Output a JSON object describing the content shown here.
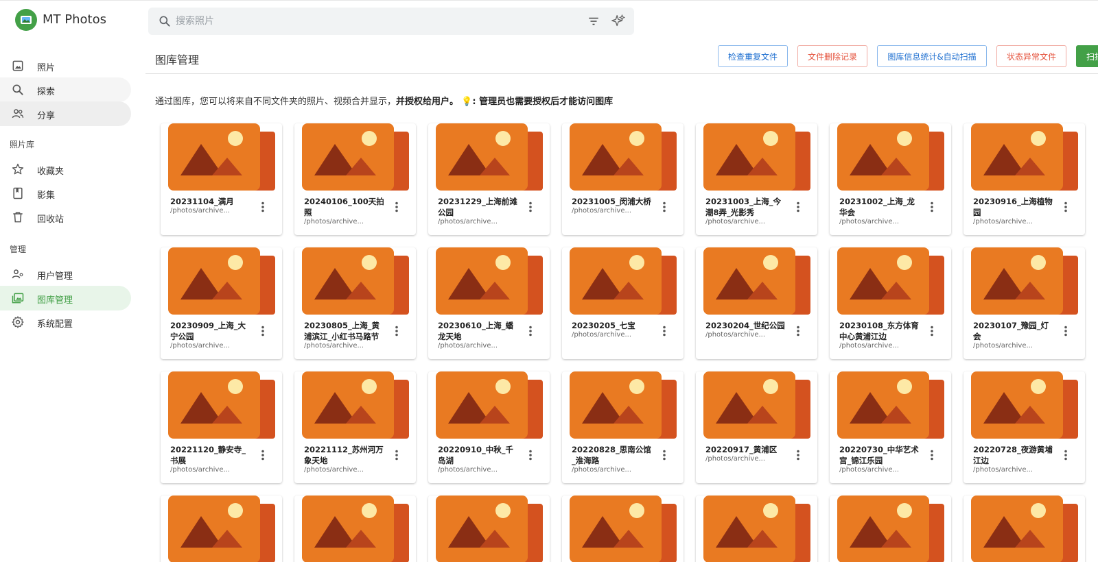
{
  "app": {
    "title": "MT Photos"
  },
  "search": {
    "placeholder": "搜索照片"
  },
  "sidebar": {
    "top_items": [
      {
        "label": "照片",
        "icon": "image-icon"
      },
      {
        "label": "探索",
        "icon": "search-icon"
      },
      {
        "label": "分享",
        "icon": "people-icon"
      }
    ],
    "section_library": "照片库",
    "library_items": [
      {
        "label": "收藏夹",
        "icon": "star-icon"
      },
      {
        "label": "影集",
        "icon": "album-icon"
      },
      {
        "label": "回收站",
        "icon": "trash-icon"
      }
    ],
    "section_manage": "管理",
    "manage_items": [
      {
        "label": "用户管理",
        "icon": "user-manage-icon"
      },
      {
        "label": "图库管理",
        "icon": "gallery-icon"
      },
      {
        "label": "系统配置",
        "icon": "gear-icon"
      }
    ]
  },
  "header": {
    "title": "图库管理",
    "buttons": [
      "检查重复文件",
      "文件删除记录",
      "图库信息统计&自动扫描",
      "状态异常文件",
      "扫描"
    ]
  },
  "intro": {
    "text": "通过图库，您可以将来自不同文件夹的照片、视频合并显示，",
    "bold": "并授权给用户。",
    "note": "💡: 管理员也需要授权后才能访问图库"
  },
  "galleries": [
    {
      "name": "20231104_满月",
      "path": "/photos/archive..."
    },
    {
      "name": "20240106_100天拍照",
      "path": "/photos/archive..."
    },
    {
      "name": "20231229_上海前滩公园",
      "path": "/photos/archive..."
    },
    {
      "name": "20231005_闵浦大桥",
      "path": "/photos/archive..."
    },
    {
      "name": "20231003_上海_今潮8弄_光影秀",
      "path": "/photos/archive..."
    },
    {
      "name": "20231002_上海_龙华会",
      "path": "/photos/archive..."
    },
    {
      "name": "20230916_上海植物园",
      "path": "/photos/archive..."
    },
    {
      "name": "20230909_上海_大宁公园",
      "path": "/photos/archive..."
    },
    {
      "name": "20230805_上海_黄浦滨江_小红书马路节",
      "path": "/photos/archive..."
    },
    {
      "name": "20230610_上海_蟠龙天地",
      "path": "/photos/archive..."
    },
    {
      "name": "20230205_七宝",
      "path": "/photos/archive..."
    },
    {
      "name": "20230204_世纪公园",
      "path": "/photos/archive..."
    },
    {
      "name": "20230108_东方体育中心黄浦江边",
      "path": "/photos/archive..."
    },
    {
      "name": "20230107_豫园_灯会",
      "path": "/photos/archive..."
    },
    {
      "name": "20221120_静安寺_书展",
      "path": "/photos/archive..."
    },
    {
      "name": "20221112_苏州河万象天地",
      "path": "/photos/archive..."
    },
    {
      "name": "20220910_中秋_千岛湖",
      "path": "/photos/archive..."
    },
    {
      "name": "20220828_思南公馆_淮海路",
      "path": "/photos/archive..."
    },
    {
      "name": "20220917_黄浦区",
      "path": "/photos/archive..."
    },
    {
      "name": "20220730_中华艺术宫_锦江乐园",
      "path": "/photos/archive..."
    },
    {
      "name": "20220728_夜游黄埔江边",
      "path": "/photos/archive..."
    },
    {
      "name": "",
      "path": ""
    },
    {
      "name": "",
      "path": ""
    },
    {
      "name": "",
      "path": ""
    },
    {
      "name": "",
      "path": ""
    },
    {
      "name": "",
      "path": ""
    },
    {
      "name": "",
      "path": ""
    },
    {
      "name": "",
      "path": ""
    }
  ],
  "colors": {
    "accent_green": "#43a047",
    "thumb_orange": "#e97a22",
    "thumb_back": "#d4521f",
    "mountain_dark": "#8a2e14",
    "mountain_mid": "#b8441c",
    "sun": "#fde9a6"
  }
}
